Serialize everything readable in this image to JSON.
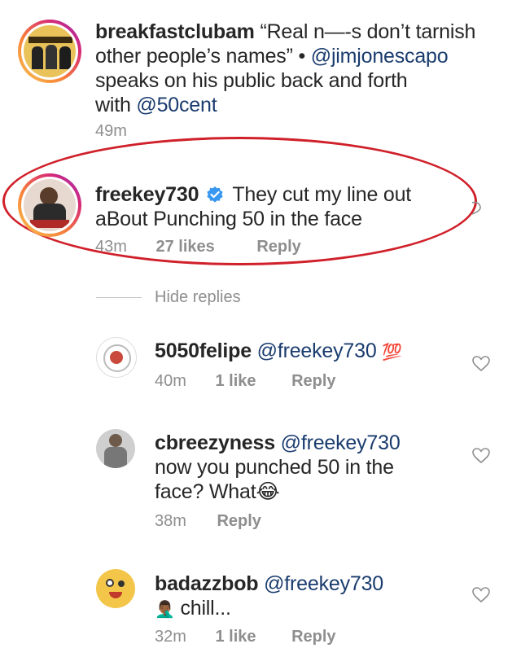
{
  "post": {
    "username": "breakfastclubam",
    "caption_lines": [
      "“Real n—-s don’t tarnish",
      "other people’s names” • ",
      "speaks on his public back and forth",
      "with "
    ],
    "mention_1": "@jimjonescapo",
    "mention_2": "@50cent",
    "time": "49m"
  },
  "comment": {
    "username": "freekey730",
    "text_line1": "They cut my line out",
    "text_line2": "aBout Punching 50 in the face",
    "time": "43m",
    "likes": "27 likes",
    "reply_label": "Reply",
    "hide_replies": "Hide replies"
  },
  "replies": [
    {
      "username": "5050felipe",
      "mention": "@freekey730",
      "emoji": "💯",
      "time": "40m",
      "likes": "1 like",
      "reply_label": "Reply"
    },
    {
      "username": "cbreezyness",
      "mention": "@freekey730",
      "line2": "now you punched 50 in the",
      "line3": "face? What",
      "emoji": "😂",
      "time": "38m",
      "reply_label": "Reply"
    },
    {
      "username": "badazzbob",
      "mention": "@freekey730",
      "emoji": "🤦🏾‍♂️",
      "line2": " chill...",
      "time": "32m",
      "likes": "1 like",
      "reply_label": "Reply"
    }
  ],
  "colors": {
    "highlight_circle": "#d0202a",
    "mention": "#1a3c6e",
    "verified_badge": "#3897f0",
    "meta_text": "#8e8e8e"
  },
  "icons": [
    "heart-icon",
    "verified-badge-icon"
  ]
}
